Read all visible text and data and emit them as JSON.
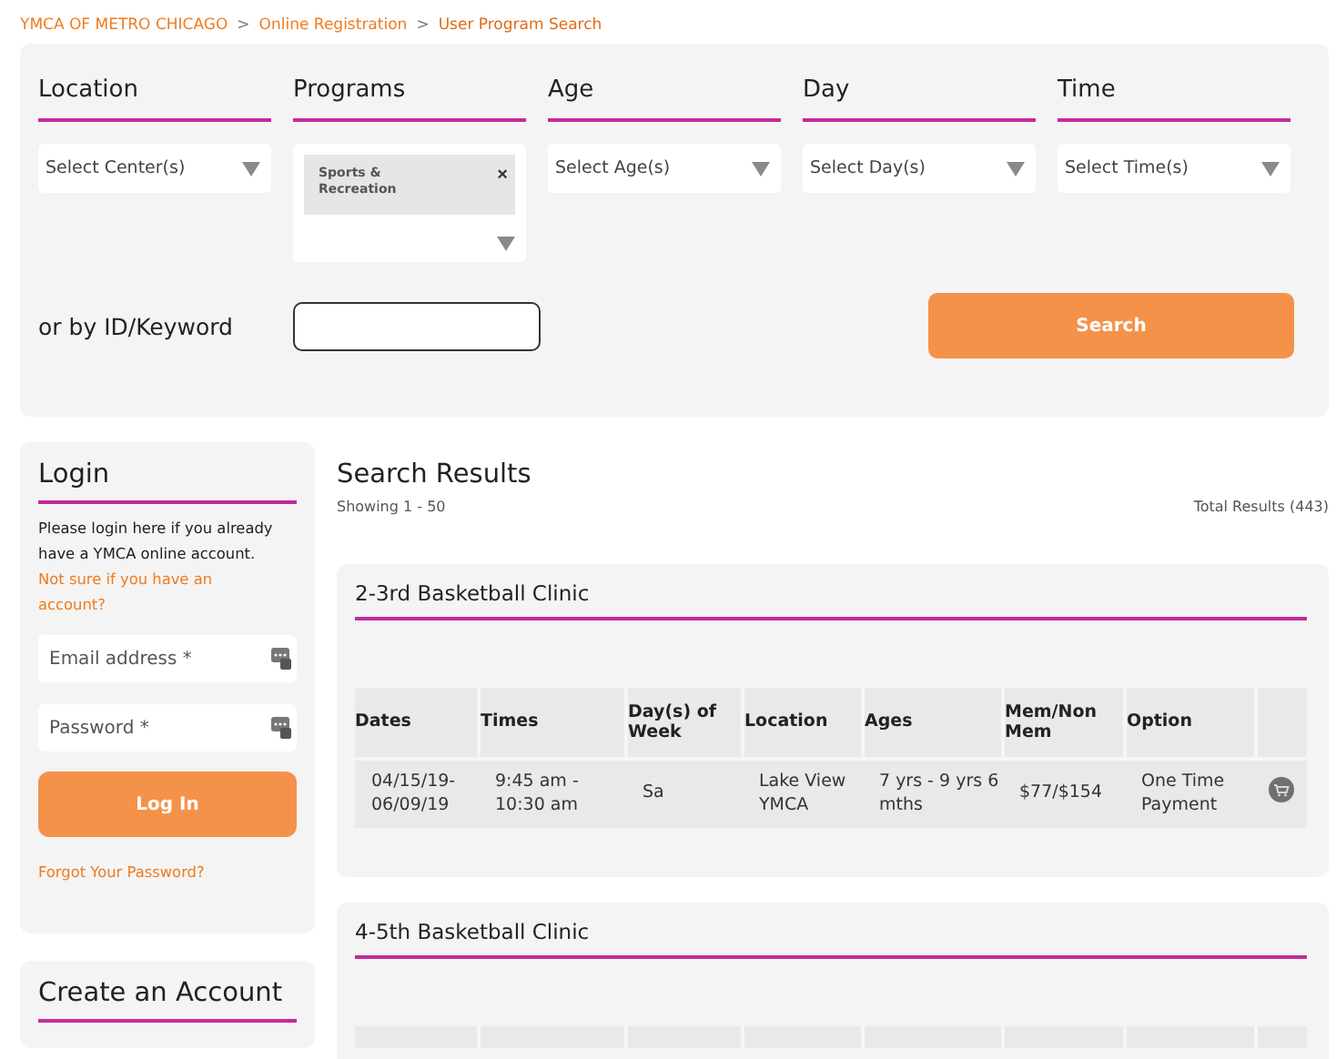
{
  "breadcrumb": [
    {
      "label": "YMCA OF METRO CHICAGO",
      "kind": "link"
    },
    {
      "label": ">",
      "kind": "separator"
    },
    {
      "label": "Online Registration",
      "kind": "link"
    },
    {
      "label": ">",
      "kind": "separator"
    },
    {
      "label": "User Program Search",
      "kind": "current"
    }
  ],
  "filters": [
    {
      "label": "Location",
      "placeholder": "Select Center(s)"
    },
    {
      "label": "Programs",
      "tags": [
        {
          "label": "Sports & Recreation",
          "remove": "×"
        }
      ]
    },
    {
      "label": "Age",
      "placeholder": "Select Age(s)"
    },
    {
      "label": "Day",
      "placeholder": "Select Day(s)"
    },
    {
      "label": "Time",
      "placeholder": "Select Time(s)"
    }
  ],
  "keyword": {
    "label": "or by ID/Keyword"
  },
  "search_button": "Search",
  "login": {
    "title": "Login",
    "text": "Please login here if you already have a YMCA online account.",
    "link": "Not sure if you have an account?",
    "fields": [
      {
        "placeholder": "Email address *"
      },
      {
        "placeholder": "Password *"
      }
    ],
    "button": "Log In",
    "forgot": "Forgot Your Password?"
  },
  "create_account": {
    "title": "Create an Account"
  },
  "results": {
    "title": "Search Results",
    "showing": "Showing 1 - 50",
    "total": "Total Results (443)",
    "programs": [
      {
        "title": "2-3rd Basketball Clinic",
        "columns": [
          "Dates",
          "Times",
          "Day(s) of Week",
          "Location",
          "Ages",
          "Mem/Non Mem",
          "Option"
        ],
        "rows": [
          [
            "04/15/19-06/09/19",
            "9:45 am - 10:30 am",
            "Sa",
            "Lake View YMCA",
            "7 yrs - 9 yrs 6 mths",
            "$77/$154",
            "One Time Payment"
          ]
        ]
      },
      {
        "title": "4-5th Basketball Clinic"
      }
    ]
  }
}
